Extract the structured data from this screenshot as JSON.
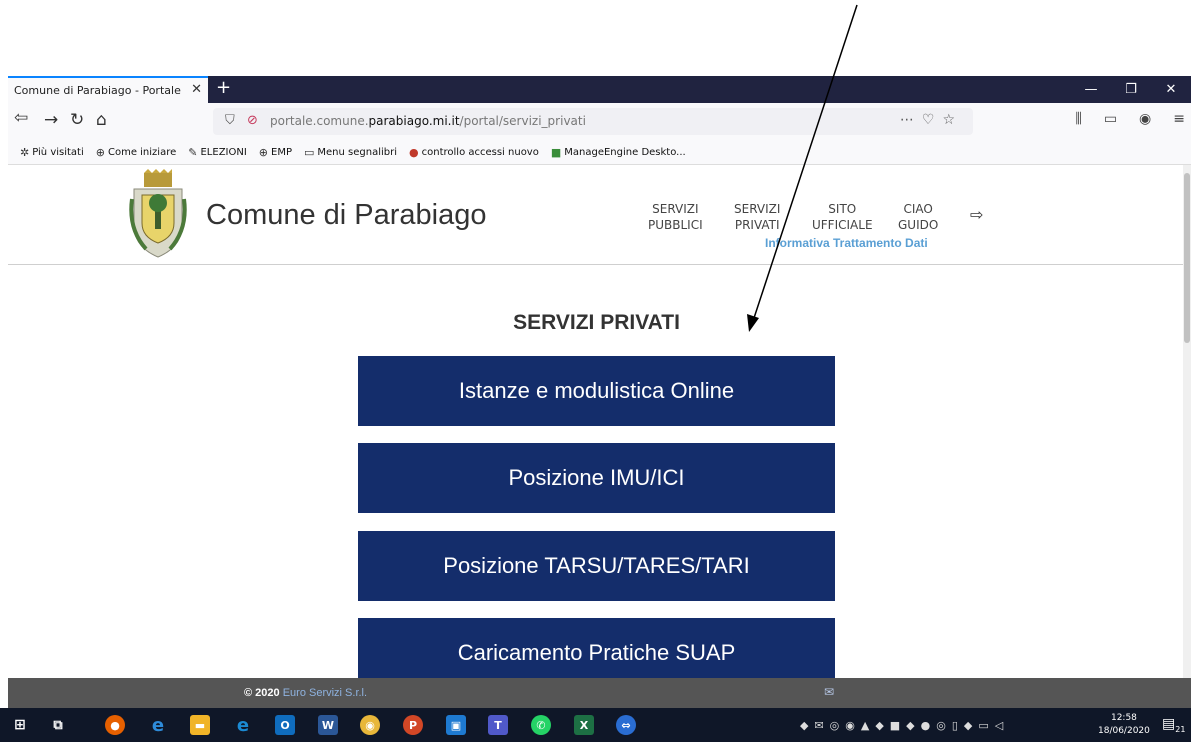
{
  "browser": {
    "tab_title": "Comune di Parabiago - Portale dei",
    "url_host_pre": "portale.comune.",
    "url_host_main": "parabiago.mi.it",
    "url_path": "/portal/servizi_privati",
    "bookmarks": [
      {
        "icon": "gear-icon",
        "label": "Più visitati"
      },
      {
        "icon": "globe-icon",
        "label": "Come iniziare"
      },
      {
        "icon": "pencil-icon",
        "label": "ELEZIONI"
      },
      {
        "icon": "globe-icon",
        "label": "EMP"
      },
      {
        "icon": "folder-icon",
        "label": "Menu segnalibri"
      },
      {
        "icon": "ball-icon",
        "label": "controllo accessi nuovo"
      },
      {
        "icon": "manageengine-icon",
        "label": "ManageEngine Deskto..."
      }
    ]
  },
  "site": {
    "name": "Comune di Parabiago",
    "menu": [
      {
        "line1": "SERVIZI",
        "line2": "PUBBLICI"
      },
      {
        "line1": "SERVIZI",
        "line2": "PRIVATI"
      },
      {
        "line1": "SITO",
        "line2": "UFFICIALE"
      },
      {
        "line1": "CIAO",
        "line2": "GUIDO"
      }
    ],
    "privacy_link": "Informativa Trattamento Dati"
  },
  "main": {
    "title": "SERVIZI PRIVATI",
    "buttons": [
      "Istanze e modulistica Online",
      "Posizione IMU/ICI",
      "Posizione TARSU/TARES/TARI",
      "Caricamento Pratiche SUAP"
    ]
  },
  "footer": {
    "copyright": "© 2020",
    "company": "Euro Servizi S.r.l."
  },
  "taskbar": {
    "time": "12:58",
    "date": "18/06/2020",
    "notifications": "21"
  },
  "colors": {
    "button_bg": "#142d6b",
    "link": "#5a9fd4",
    "tab_strip": "#202340"
  }
}
